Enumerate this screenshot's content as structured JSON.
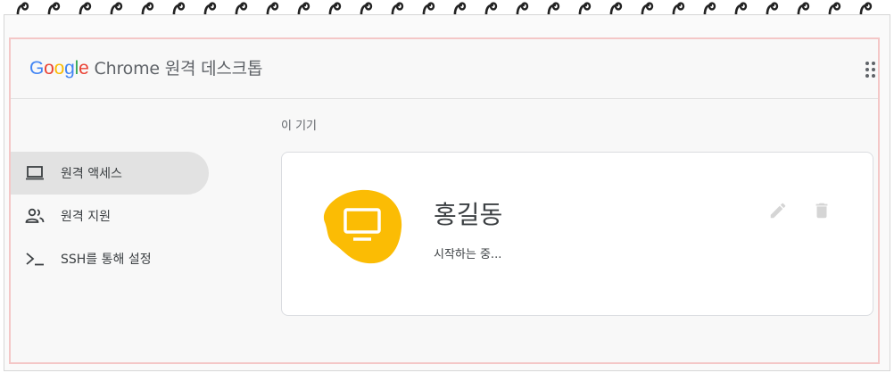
{
  "header": {
    "logo_google": [
      "G",
      "o",
      "o",
      "g",
      "l",
      "e"
    ],
    "product_name": "Chrome 원격 데스크톱"
  },
  "sidebar": {
    "items": [
      {
        "label": "원격 액세스",
        "icon": "laptop-icon",
        "active": true
      },
      {
        "label": "원격 지원",
        "icon": "people-icon",
        "active": false
      },
      {
        "label": "SSH를 통해 설정",
        "icon": "terminal-icon",
        "active": false
      }
    ]
  },
  "main": {
    "section_title": "이 기기",
    "device": {
      "name": "홍길동",
      "status": "시작하는 중...",
      "icon": "monitor-icon",
      "actions": [
        "edit-icon",
        "delete-icon"
      ]
    }
  },
  "colors": {
    "accent_yellow": "#fbbc04",
    "active_nav_bg": "#e2e2e2",
    "frame_border": "#f4c7c7"
  }
}
